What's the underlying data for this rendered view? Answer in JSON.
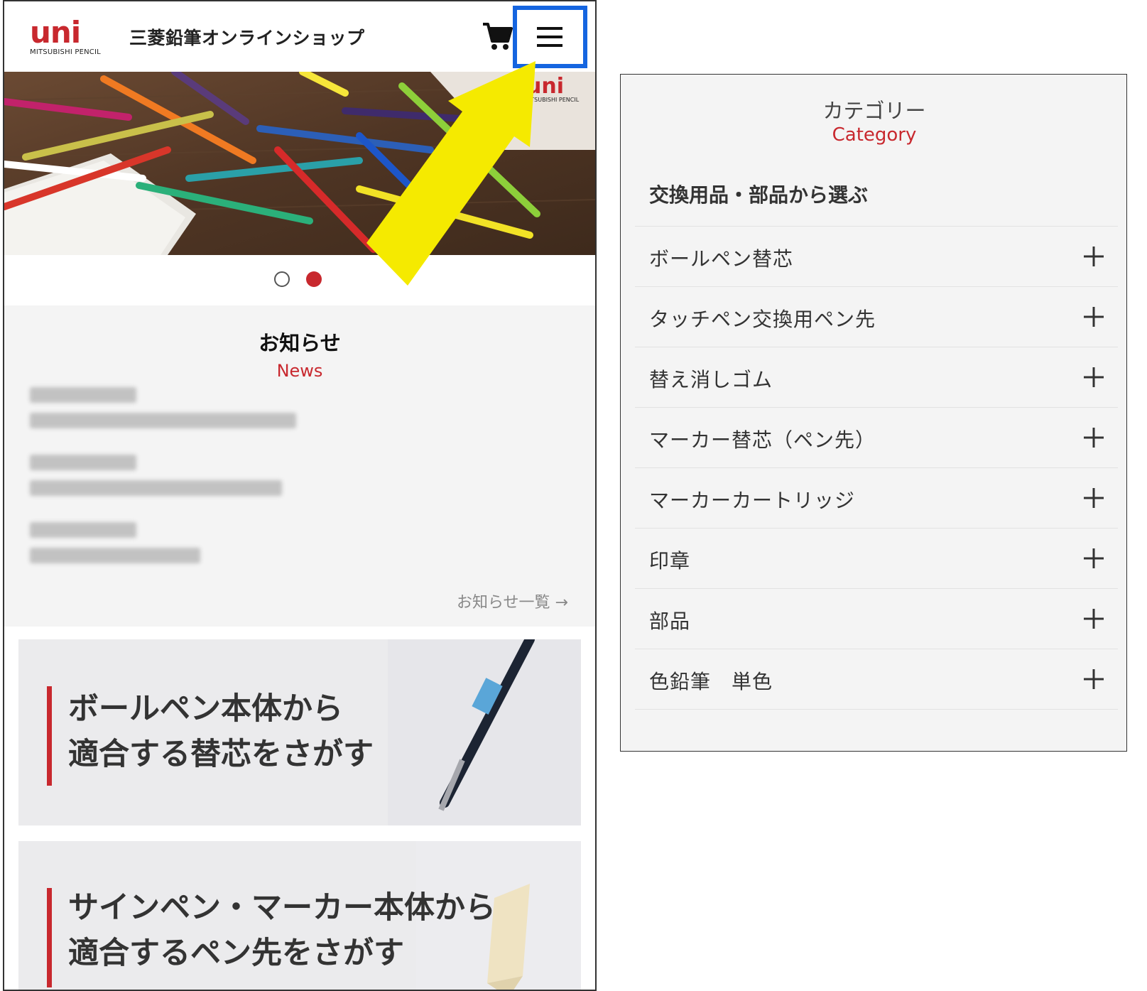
{
  "header": {
    "logo_mark": "uni",
    "logo_sub": "MITSUBISHI PENCIL",
    "shop_title": "三菱鉛筆オンラインショップ",
    "cart_icon": "cart-icon",
    "menu_icon": "hamburger-menu-icon"
  },
  "hero": {
    "logo_mark": "uni",
    "logo_sub": "MITSUBISHI PENCIL"
  },
  "carousel": {
    "slide_count": 2,
    "active_index": 1
  },
  "news": {
    "title": "お知らせ",
    "subtitle": "News",
    "more_link": "お知らせ一覧 →"
  },
  "banners": [
    {
      "line1": "ボールペン本体から",
      "line2": "適合する替芯をさがす"
    },
    {
      "line1": "サインペン・マーカー本体から",
      "line2": "適合するペン先をさがす"
    }
  ],
  "annotation": {
    "highlight_color": "#1565e0",
    "arrow_color": "#f5ea00"
  },
  "drawer": {
    "title": "カテゴリー",
    "subtitle": "Category",
    "section_heading": "交換用品・部品から選ぶ",
    "items": [
      {
        "label": "ボールペン替芯"
      },
      {
        "label": "タッチペン交換用ペン先"
      },
      {
        "label": "替え消しゴム"
      },
      {
        "label": "マーカー替芯（ペン先）"
      },
      {
        "label": "マーカーカートリッジ"
      },
      {
        "label": "印章"
      },
      {
        "label": "部品"
      },
      {
        "label": "色鉛筆　単色"
      }
    ]
  },
  "colors": {
    "brand_red": "#c8282e",
    "panel_bg": "#f4f4f4"
  }
}
